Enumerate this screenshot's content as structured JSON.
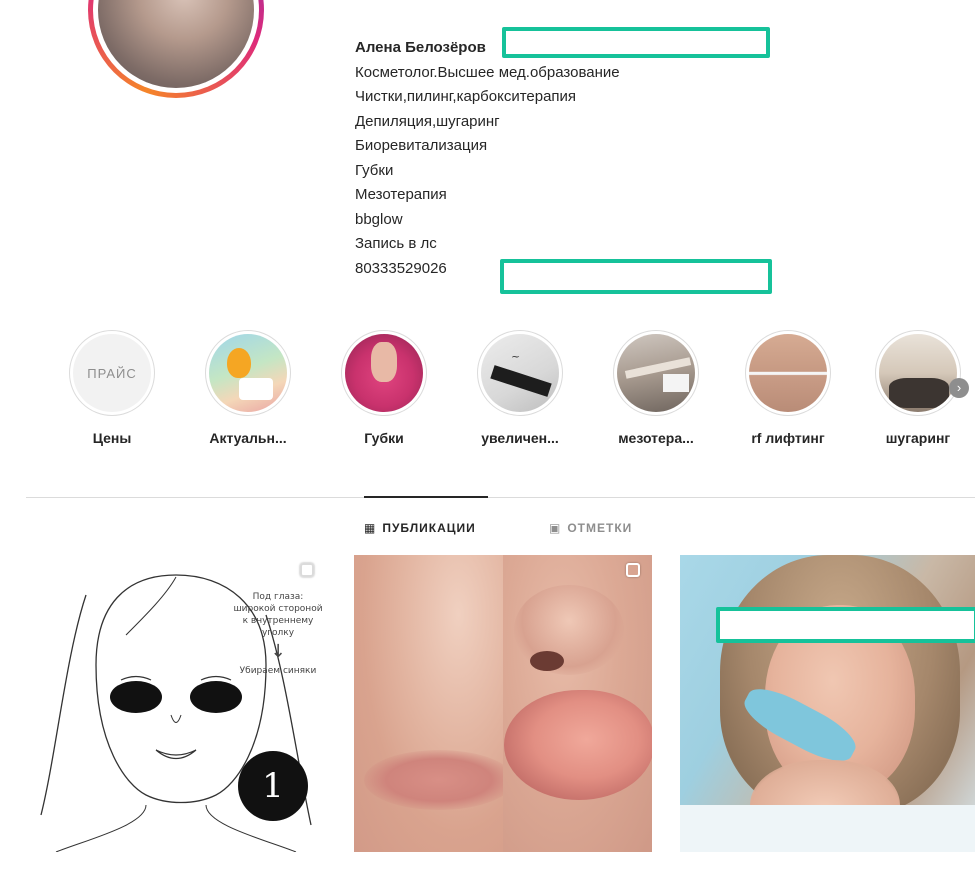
{
  "profile": {
    "bio_lines": [
      "Алена Белозёров",
      "Косметолог.Высшее мед.образование",
      "Чистки,пилинг,карбокситерапия",
      "Депиляция,шугаринг",
      "Биоревитализация",
      "Губки",
      "Мезотерапия",
      "bbglow",
      "Запись в лс",
      "80333529026"
    ]
  },
  "highlights": [
    {
      "label": "Цены",
      "image_text": "ПРАЙС"
    },
    {
      "label": "Актуальн..."
    },
    {
      "label": "Губки"
    },
    {
      "label": "увеличен..."
    },
    {
      "label": "мезотера..."
    },
    {
      "label": "rf лифтинг"
    },
    {
      "label": "шугаринг"
    }
  ],
  "tabs": {
    "publications": "ПУБЛИКАЦИИ",
    "tagged": "ОТМЕТКИ"
  },
  "posts": {
    "post1_text": [
      "Под глаза:",
      "широкой стороной",
      "к внутреннему",
      "уголку",
      "↓",
      "Убираем синяки"
    ]
  },
  "colors": {
    "redaction_border": "#16c29a",
    "text_primary": "#262626",
    "text_secondary": "#8e8e8e",
    "divider": "#dbdbdb"
  },
  "icons": {
    "grid": "grid-icon",
    "tagged": "tagged-photo-icon",
    "next": "chevron-right-icon",
    "multi": "multiple-photos-icon"
  }
}
